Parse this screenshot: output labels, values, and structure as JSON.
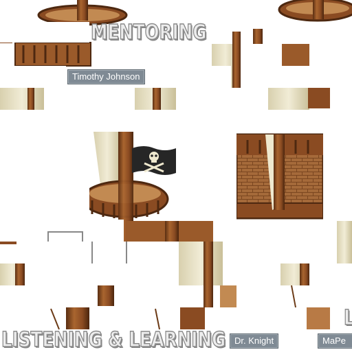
{
  "banners": {
    "mentoring": "MENTORING",
    "listening": "LISTENING & LEARNING",
    "edge_letter": "L"
  },
  "name_tags": {
    "timothy": "Timothy Johnson",
    "knight": "Dr. Knight",
    "partial": "MaPe"
  },
  "colors": {
    "wood": "#8a4b22",
    "wood_dark": "#4d2810",
    "wood_light": "#b87a45",
    "sail": "#efe9cf",
    "sail_shadow": "#cfc6a0",
    "flag": "#262626",
    "tag_bg": "#7f8a94"
  },
  "icons": {
    "flag": "jolly-roger-flag-icon"
  }
}
